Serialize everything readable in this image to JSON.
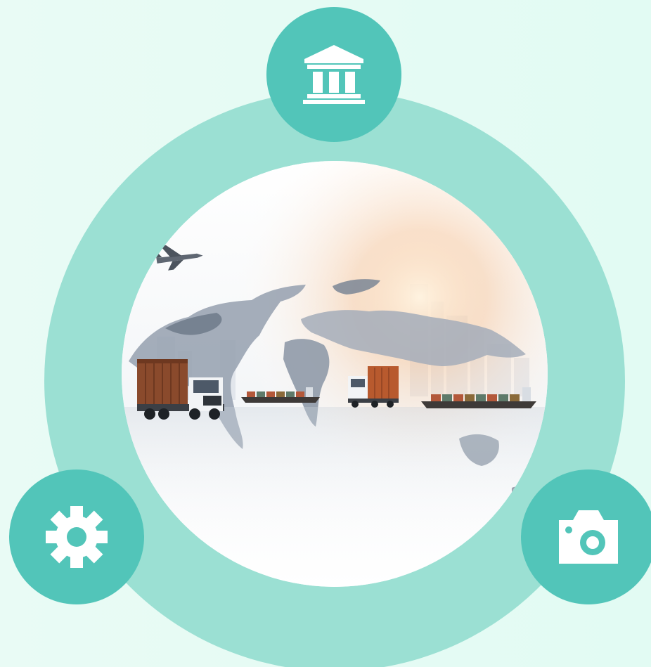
{
  "colors": {
    "background_left": "#e9fbf5",
    "background_right": "#e2fbf3",
    "ring": "#9be0d3",
    "badge": "#52c5b9",
    "icon": "#ffffff",
    "map_land": "#9aa4b2",
    "map_land_dark": "#6f7a89",
    "sunlight": "#f7c9a1"
  },
  "badges": [
    {
      "icon": "bank-icon"
    },
    {
      "icon": "gear-icon"
    },
    {
      "icon": "camera-icon"
    }
  ],
  "photo": {
    "subject": "logistics-world-map",
    "elements": [
      "airplane",
      "truck-left",
      "cargo-ship-left",
      "truck-center",
      "cargo-ship-right",
      "city-skyline",
      "sunlight"
    ]
  }
}
